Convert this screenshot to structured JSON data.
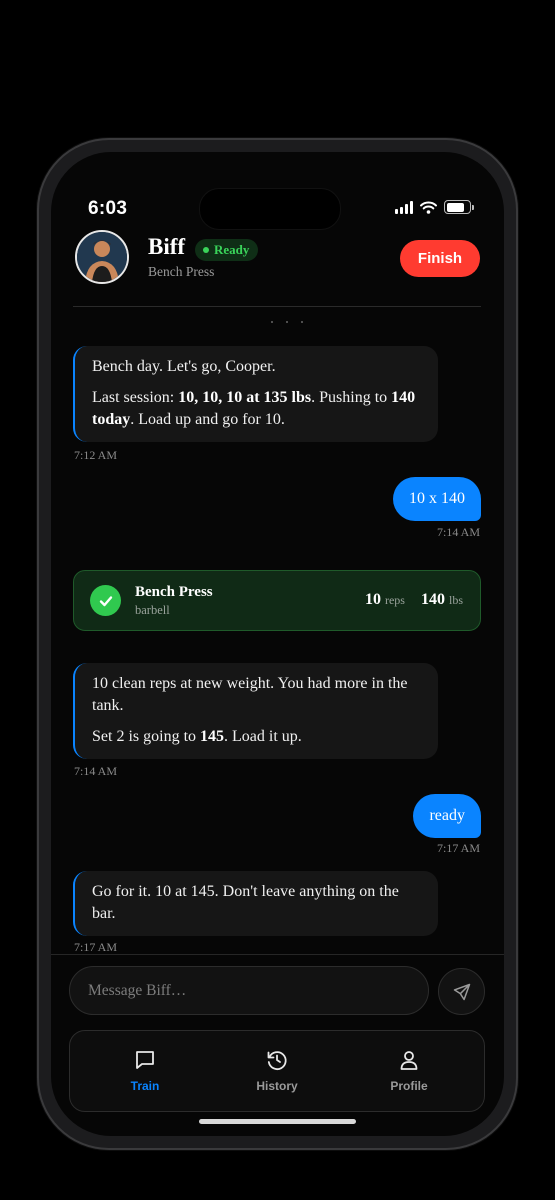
{
  "status_bar": {
    "time": "6:03",
    "battery_level": 0.85
  },
  "header": {
    "coach_name": "Biff",
    "status_badge": "Ready",
    "subtitle": "Bench Press",
    "finish_label": "Finish"
  },
  "messages": [
    {
      "from": "coach",
      "paragraphs": [
        [
          {
            "t": "Bench day. Let's go, Cooper."
          }
        ],
        [
          {
            "t": "Last session: "
          },
          {
            "t": "10, 10, 10 at 135 lbs",
            "b": true
          },
          {
            "t": ". Pushing to "
          },
          {
            "t": "140 today",
            "b": true
          },
          {
            "t": ". Load up and go for 10."
          }
        ]
      ],
      "time": "7:12 AM"
    },
    {
      "from": "user",
      "text": "10 x 140",
      "time": "7:14 AM"
    },
    {
      "from": "coach",
      "paragraphs": [
        [
          {
            "t": "10 clean reps at new weight. You had more in the tank."
          }
        ],
        [
          {
            "t": "Set 2 is going to "
          },
          {
            "t": "145",
            "b": true
          },
          {
            "t": ". Load it up."
          }
        ]
      ],
      "time": "7:14 AM"
    },
    {
      "from": "user",
      "text": "ready",
      "time": "7:17 AM"
    },
    {
      "from": "coach",
      "paragraphs": [
        [
          {
            "t": "Go for it. 10 at 145. Don't leave anything on the bar."
          }
        ]
      ],
      "time": "7:17 AM"
    }
  ],
  "logged_set": {
    "exercise": "Bench Press",
    "equipment": "barbell",
    "reps": "10",
    "reps_unit": "reps",
    "weight": "140",
    "weight_unit": "lbs"
  },
  "composer": {
    "placeholder": "Message Biff…"
  },
  "tabs": [
    {
      "label": "Train",
      "icon": "chat-bubble-icon",
      "active": true
    },
    {
      "label": "History",
      "icon": "history-clock-icon",
      "active": false
    },
    {
      "label": "Profile",
      "icon": "person-icon",
      "active": false
    }
  ],
  "colors": {
    "accent": "#0a84ff",
    "finish": "#ff3b30",
    "success": "#30c94f",
    "ready": "#3ad35a"
  }
}
